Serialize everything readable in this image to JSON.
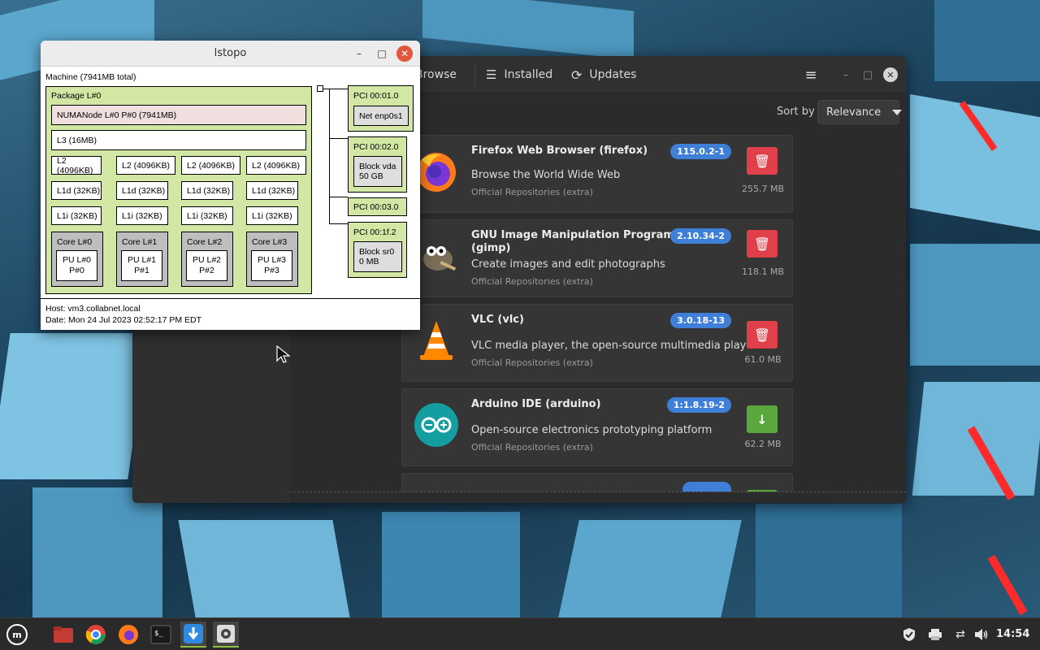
{
  "mint": {
    "tabs": [
      {
        "label": "Browse",
        "icon": "browse-icon"
      },
      {
        "label": "Installed",
        "icon": "list-icon"
      },
      {
        "label": "Updates",
        "icon": "refresh-icon"
      }
    ],
    "sort_label": "Sort by",
    "sort_value": "Relevance",
    "apps": [
      {
        "title": "Firefox Web Browser (firefox)",
        "summary": "Browse the World Wide Web",
        "origin": "Official Repositories (extra)",
        "version": "115.0.2-1",
        "size": "255.7 MB",
        "action": "remove"
      },
      {
        "title": "GNU Image Manipulation Program (gimp)",
        "summary": "Create images and edit photographs",
        "origin": "Official Repositories (extra)",
        "version": "2.10.34-2",
        "size": "118.1 MB",
        "action": "remove"
      },
      {
        "title": "VLC (vlc)",
        "summary": "VLC media player, the open-source multimedia player",
        "origin": "Official Repositories (extra)",
        "version": "3.0.18-13",
        "size": "61.0 MB",
        "action": "remove"
      },
      {
        "title": "Arduino IDE (arduino)",
        "summary": "Open-source electronics prototyping platform",
        "origin": "Official Repositories (extra)",
        "version": "1:1.8.19-2",
        "size": "62.2 MB",
        "action": "install"
      }
    ]
  },
  "lstopo": {
    "title": "lstopo",
    "machine": "Machine (7941MB total)",
    "package": "Package L#0",
    "numa": "NUMANode L#0 P#0 (7941MB)",
    "l3": "L3 (16MB)",
    "l2": [
      "L2 (4096KB)",
      "L2 (4096KB)",
      "L2 (4096KB)",
      "L2 (4096KB)"
    ],
    "l1d": [
      "L1d (32KB)",
      "L1d (32KB)",
      "L1d (32KB)",
      "L1d (32KB)"
    ],
    "l1i": [
      "L1i (32KB)",
      "L1i (32KB)",
      "L1i (32KB)",
      "L1i (32KB)"
    ],
    "cores": [
      "Core L#0",
      "Core L#1",
      "Core L#2",
      "Core L#3"
    ],
    "pus": [
      {
        "line1": "PU L#0",
        "line2": "P#0"
      },
      {
        "line1": "PU L#1",
        "line2": "P#1"
      },
      {
        "line1": "PU L#2",
        "line2": "P#2"
      },
      {
        "line1": "PU L#3",
        "line2": "P#3"
      }
    ],
    "pci": [
      {
        "label": "PCI 00:01.0",
        "dev1": "Net enp0s1",
        "dev2": ""
      },
      {
        "label": "PCI 00:02.0",
        "dev1": "Block vda",
        "dev2": "50 GB"
      },
      {
        "label": "PCI 00:03.0",
        "dev1": "",
        "dev2": ""
      },
      {
        "label": "PCI 00:1f.2",
        "dev1": "Block sr0",
        "dev2": "0 MB"
      }
    ],
    "host": "Host: vm3.collabnet.local",
    "date": "Date: Mon 24 Jul 2023 02:52:17 PM EDT"
  },
  "taskbar": {
    "items": [
      "mint-menu-icon",
      "files-icon",
      "chrome-icon",
      "firefox-icon",
      "terminal-icon",
      "software-manager-icon",
      "settings-icon"
    ],
    "tray": [
      "shield-icon",
      "printer-icon",
      "network-icon",
      "volume-icon"
    ],
    "clock": "14:54"
  },
  "colors": {
    "remove": "#e0404a",
    "install": "#5aa83c",
    "badge": "#3e7fd8",
    "lstopo_green": "#d2e7a4"
  }
}
